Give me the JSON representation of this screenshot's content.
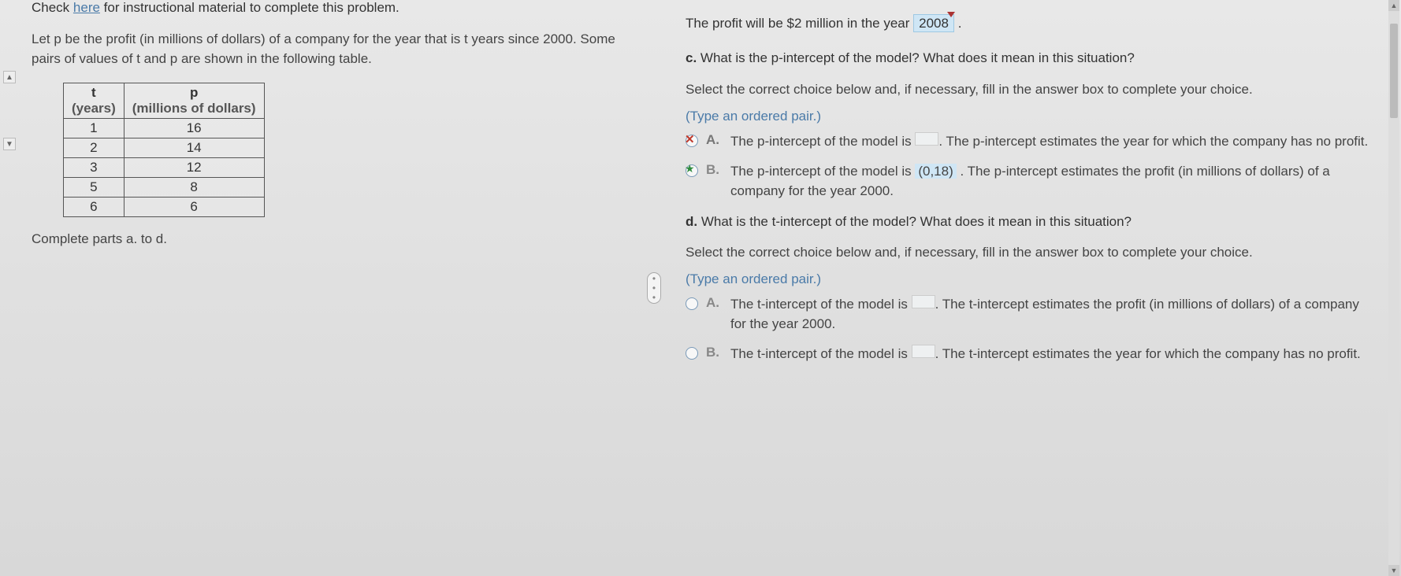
{
  "left": {
    "check_pre": "Check ",
    "check_link": "here",
    "check_post": " for instructional material to complete this problem.",
    "prompt": "Let p be the profit (in millions of dollars) of a company for the year that is t years since 2000. Some pairs of values of t and p are shown in the following table.",
    "table": {
      "head_t": "t",
      "head_t_sub": "(years)",
      "head_p": "p",
      "head_p_sub": "(millions of dollars)",
      "rows": [
        {
          "t": "1",
          "p": "16"
        },
        {
          "t": "2",
          "p": "14"
        },
        {
          "t": "3",
          "p": "12"
        },
        {
          "t": "5",
          "p": "8"
        },
        {
          "t": "6",
          "p": "6"
        }
      ]
    },
    "complete": "Complete parts a. to d."
  },
  "right": {
    "b_answer_pre": "The profit will be $2 million in the year ",
    "b_answer_val": "2008",
    "b_answer_post": " .",
    "c": {
      "label": "c.",
      "question": "What is the p-intercept of the model? What does it mean in this situation?",
      "instr": "Select the correct choice below and, if necessary, fill in the answer box to complete your choice.",
      "hint": "(Type an ordered pair.)",
      "A": {
        "letter": "A.",
        "t1": "The p-intercept of the model is ",
        "t2": ". The p-intercept estimates the year for which the company has no profit."
      },
      "B": {
        "letter": "B.",
        "t1": "The p-intercept of the model is ",
        "val": "(0,18)",
        "t2": " . The p-intercept estimates the profit (in millions of dollars) of a company for the year 2000."
      }
    },
    "d": {
      "label": "d.",
      "question": "What is the t-intercept of the model? What does it mean in this situation?",
      "instr": "Select the correct choice below and, if necessary, fill in the answer box to complete your choice.",
      "hint": "(Type an ordered pair.)",
      "A": {
        "letter": "A.",
        "t1": "The t-intercept of the model is ",
        "t2": ". The t-intercept estimates the profit (in millions of dollars) of a company for the year 2000."
      },
      "B": {
        "letter": "B.",
        "t1": "The t-intercept of the model is ",
        "t2": ". The t-intercept estimates the year for which the company has no profit."
      }
    }
  },
  "chart_data": {
    "type": "table",
    "title": "Profit p (millions of dollars) vs years t since 2000",
    "columns": [
      "t (years)",
      "p (millions of dollars)"
    ],
    "rows": [
      [
        1,
        16
      ],
      [
        2,
        14
      ],
      [
        3,
        12
      ],
      [
        5,
        8
      ],
      [
        6,
        6
      ]
    ]
  }
}
